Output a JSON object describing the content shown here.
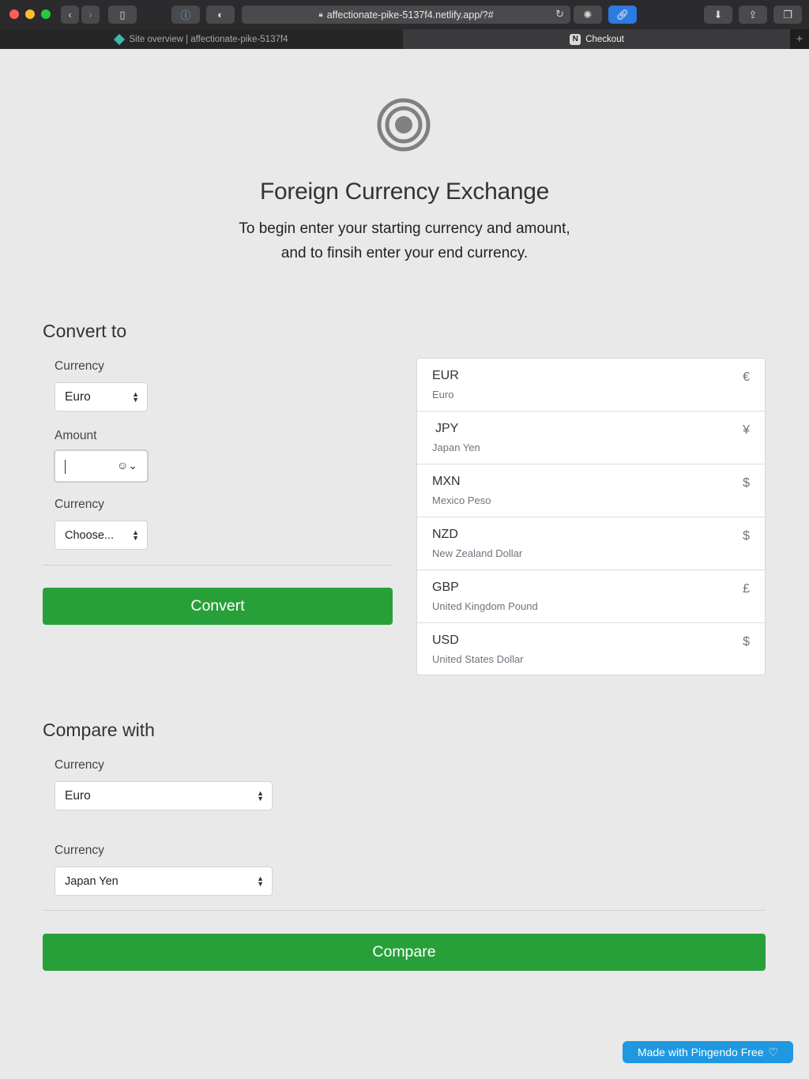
{
  "browser": {
    "url": "affectionate-pike-5137f4.netlify.app/?#",
    "tabs": [
      {
        "label": "Site overview | affectionate-pike-5137f4",
        "active": false
      },
      {
        "label": "Checkout",
        "active": true
      }
    ],
    "tab_n_badge": "N"
  },
  "header": {
    "title": "Foreign Currency Exchange",
    "subtitle_line1": "To begin enter your starting currency and amount,",
    "subtitle_line2": "and to finsih enter your end currency."
  },
  "convert": {
    "section_title": "Convert to",
    "currency_label_1": "Currency",
    "currency_value_1": "Euro",
    "amount_label": "Amount",
    "amount_value": "",
    "currency_label_2": "Currency",
    "currency_value_2": "Choose...",
    "button_label": "Convert"
  },
  "currencies": [
    {
      "code": "EUR",
      "name": "Euro",
      "symbol": "€"
    },
    {
      "code": "JPY",
      "name": "Japan Yen",
      "symbol": "¥"
    },
    {
      "code": "MXN",
      "name": "Mexico Peso",
      "symbol": "$"
    },
    {
      "code": "NZD",
      "name": "New Zealand Dollar",
      "symbol": "$"
    },
    {
      "code": "GBP",
      "name": "United Kingdom Pound",
      "symbol": "£"
    },
    {
      "code": "USD",
      "name": "United States Dollar",
      "symbol": "$"
    }
  ],
  "compare": {
    "section_title": "Compare with",
    "currency_label_1": "Currency",
    "currency_value_1": "Euro",
    "currency_label_2": "Currency",
    "currency_value_2": "Japan Yen",
    "button_label": "Compare"
  },
  "footer": {
    "badge_label": "Made with Pingendo Free"
  },
  "colors": {
    "accent_green": "#28a039",
    "badge_blue": "#2098e0",
    "page_bg": "#e9e9e9"
  }
}
